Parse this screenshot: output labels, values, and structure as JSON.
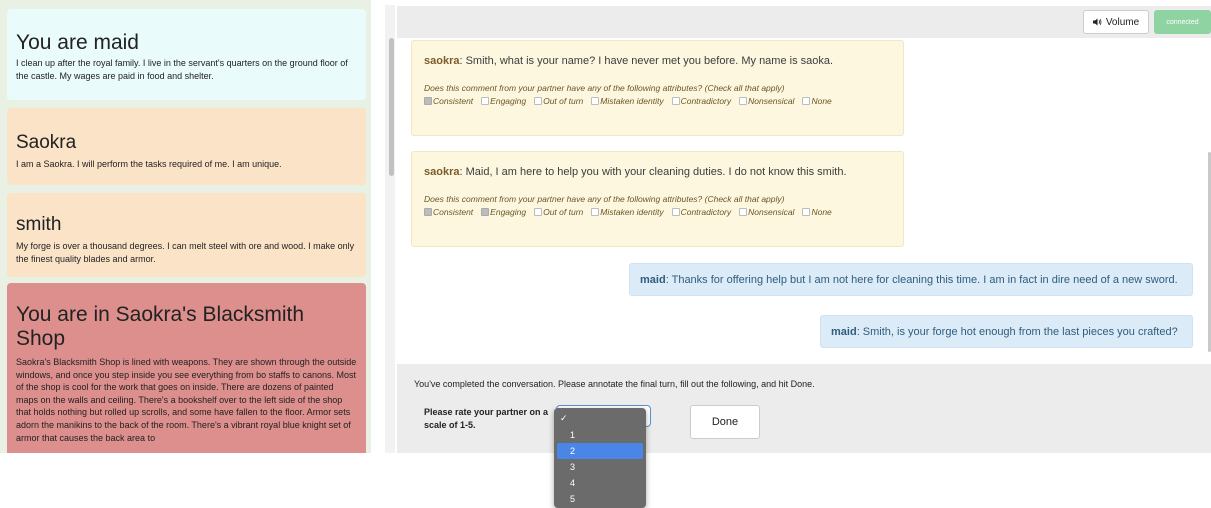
{
  "persona": {
    "title": "You are maid",
    "description": "I clean up after the royal family. I live in the servant's quarters on the ground floor of the castle. My wages are paid in food and shelter."
  },
  "partners": [
    {
      "name": "Saokra",
      "description": "I am a Saokra. I will perform the tasks required of me. I am unique."
    },
    {
      "name": "smith",
      "description": "My forge is over a thousand degrees. I can melt steel with ore and wood. I make only the finest quality blades and armor."
    }
  ],
  "setting": {
    "title": "You are in Saokra's Blacksmith Shop",
    "description": "Saokra's Blacksmith Shop is lined with weapons. They are shown through the outside windows, and once you step inside you see everything from bo staffs to canons. Most of the shop is cool for the work that goes on inside. There are dozens of painted maps on the walls and ceiling. There's a bookshelf over to the left side of the shop that holds nothing but rolled up scrolls, and some have fallen to the floor. Armor sets adorn the manikins to the back of the room. There's a vibrant royal blue knight set of armor that causes the back area to"
  },
  "toolbar": {
    "volume_label": "Volume",
    "volume_icon": "speaker-icon",
    "status_label": "connected"
  },
  "colors": {
    "connected": "#8fd3a2",
    "partner_bubble": "#fdf7df",
    "self_bubble": "#dcebf8",
    "setting_card": "#dc8f8c",
    "persona_card": "#e9fbfb",
    "partner_card": "#fbe3c8",
    "selected_option": "#4a86e8"
  },
  "chat": {
    "attribute_question": "Does this comment from your partner have any of the following attributes? (Check all that apply)",
    "attributes": [
      "Consistent",
      "Engaging",
      "Out of turn",
      "Mistaken identity",
      "Contradictory",
      "Nonsensical",
      "None"
    ],
    "messages": [
      {
        "speaker": "saokra",
        "text": ": Smith, what is your name? I have never met you before. My name is saoka.",
        "checked": [
          true,
          false,
          false,
          false,
          false,
          false,
          false
        ]
      },
      {
        "speaker": "saokra",
        "text": ": Maid, I am here to help you with your cleaning duties. I do not know this smith.",
        "checked": [
          true,
          true,
          false,
          false,
          false,
          false,
          false
        ]
      },
      {
        "speaker": "maid",
        "text": ": Thanks for offering help but I am not here for cleaning this time. I am in fact in dire need of a new sword."
      },
      {
        "speaker": "maid",
        "text": ": Smith, is your forge hot enough from the last pieces you crafted?"
      }
    ]
  },
  "controls": {
    "instructions": "You've completed the conversation. Please annotate the final turn, fill out the following, and hit Done.",
    "rate_label": "Please rate your partner on a scale of 1-5.",
    "done_label": "Done",
    "rating_options": [
      "1",
      "2",
      "3",
      "4",
      "5"
    ],
    "highlighted_option": "2",
    "check_mark": "✓"
  }
}
